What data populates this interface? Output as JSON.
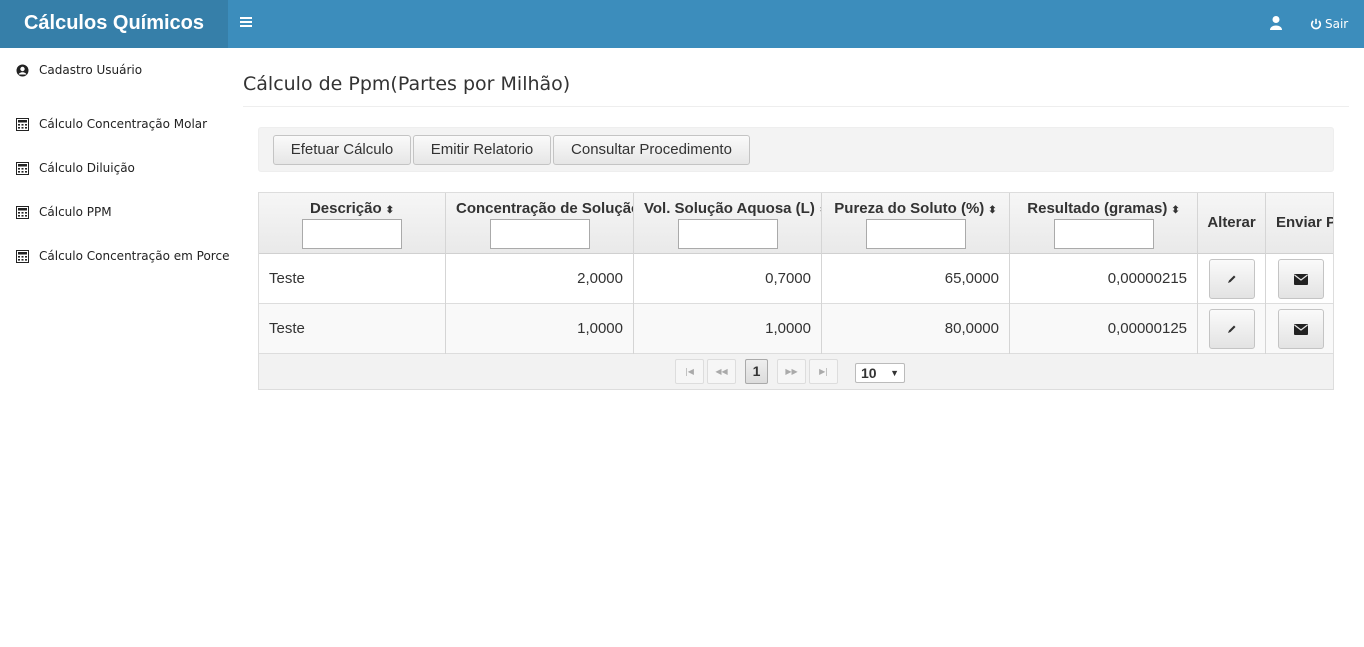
{
  "brand": "Cálculos Químicos",
  "navbar": {
    "menu_icon": "hamburger-icon",
    "user_icon": "user-icon",
    "logout_icon": "power-icon",
    "logout_label": "Sair",
    "accent": "#3c8dbc",
    "brand_bg": "#367fa9"
  },
  "sidebar": {
    "items": [
      {
        "label": "Cadastro Usuário",
        "icon": "user-circle-icon"
      },
      {
        "label": "Cálculo Concentração Molar",
        "icon": "calculator-icon"
      },
      {
        "label": "Cálculo Diluição",
        "icon": "calculator-icon"
      },
      {
        "label": "Cálculo PPM",
        "icon": "calculator-icon"
      },
      {
        "label": "Cálculo Concentração em Porcentagem",
        "icon": "calculator-icon"
      }
    ]
  },
  "page": {
    "title": "Cálculo de Ppm(Partes por Milhão)"
  },
  "toolbar": {
    "buttons": [
      "Efetuar Cálculo",
      "Emitir Relatorio",
      "Consultar Procedimento"
    ]
  },
  "table": {
    "columns": [
      {
        "label": "Descrição",
        "sortable": true,
        "filter": ""
      },
      {
        "label": "Concentração de Solução",
        "sortable": true,
        "filter": ""
      },
      {
        "label": "Vol. Solução Aquosa (L)",
        "sortable": true,
        "filter": ""
      },
      {
        "label": "Pureza do Soluto (%)",
        "sortable": true,
        "filter": ""
      },
      {
        "label": "Resultado (gramas)",
        "sortable": true,
        "filter": ""
      },
      {
        "label": "Alterar",
        "sortable": false
      },
      {
        "label": "Enviar Por Email",
        "sortable": false
      }
    ],
    "sort_icon": "sort-icon",
    "rows": [
      {
        "descricao": "Teste",
        "concentracao": "2,0000",
        "volume": "0,7000",
        "pureza": "65,0000",
        "resultado": "0,00000215",
        "edit_icon": "pencil-icon",
        "mail_icon": "envelope-icon"
      },
      {
        "descricao": "Teste",
        "concentracao": "1,0000",
        "volume": "1,0000",
        "pureza": "80,0000",
        "resultado": "0,00000125",
        "edit_icon": "pencil-icon",
        "mail_icon": "envelope-icon"
      }
    ],
    "paginator": {
      "first_icon": "first-page-icon",
      "prev_icon": "prev-page-icon",
      "next_icon": "next-page-icon",
      "last_icon": "last-page-icon",
      "current_page": "1",
      "rows_per_page": "10"
    }
  }
}
